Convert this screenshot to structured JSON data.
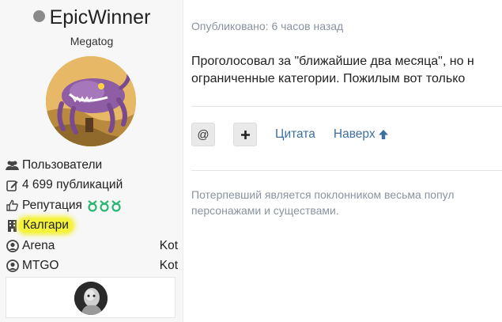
{
  "author": {
    "name": "EpicWinner",
    "title": "Megatog",
    "info": [
      {
        "icon": "users-icon",
        "label": "Пользователи",
        "value": ""
      },
      {
        "icon": "edit-icon",
        "label": "4 699 публикаций",
        "value": ""
      },
      {
        "icon": "thumbs-up-icon",
        "label": "Репутация",
        "value": ""
      },
      {
        "icon": "building-icon",
        "label": "Калгари",
        "value": ""
      },
      {
        "icon": "user-circle-icon",
        "label": "Arena",
        "value": "Kot"
      },
      {
        "icon": "user-circle-icon",
        "label": "MTGO",
        "value": "Kot"
      }
    ],
    "reputation_color": "#2bb673",
    "highlight_color": "#f4f23a"
  },
  "post": {
    "meta": "Опубликовано: 6 часов назад",
    "body_lines": [
      "Проголосовал за \"ближайшие два месяца\", но н",
      "ограниченные категории. Пожилым вот только"
    ],
    "actions": {
      "mention": "@",
      "multiquote": "+",
      "quote": "Цитата",
      "top": "Наверх"
    },
    "signature_lines": [
      "Потерпевший является поклонником весьма попул",
      "персонажами и существами."
    ],
    "link_color": "#3d6fa0"
  }
}
